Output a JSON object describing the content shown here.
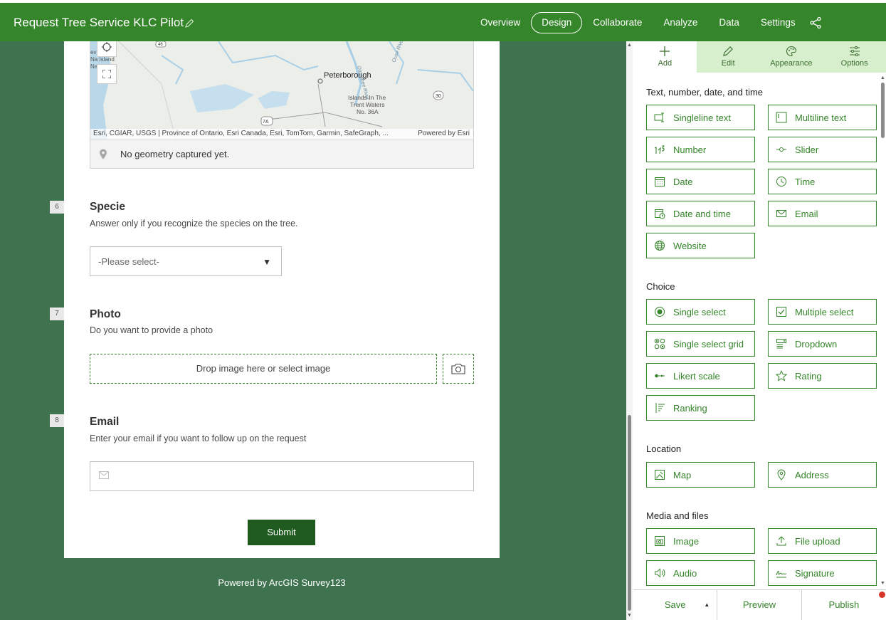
{
  "header": {
    "title": "Request Tree Service KLC Pilot",
    "nav": [
      "Overview",
      "Design",
      "Collaborate",
      "Analyze",
      "Data",
      "Settings"
    ],
    "active_nav": "Design"
  },
  "form": {
    "map": {
      "labels": [
        "Peterborough",
        "Islands In The",
        "Trent Waters",
        "No. 36A",
        "Na Island",
        "ev",
        "Na",
        "46",
        "30",
        "7A",
        "Otonabee River",
        "Ouse River"
      ],
      "attribution": "Esri, CGIAR, USGS | Province of Ontario, Esri Canada, Esri, TomTom, Garmin, SafeGraph, ...",
      "powered": "Powered by Esri",
      "status": "No geometry captured yet."
    },
    "questions": [
      {
        "number": "6",
        "title": "Specie",
        "hint": "Answer only if you recognize the species on the tree."
      },
      {
        "number": "7",
        "title": "Photo",
        "hint": "Do you want to provide a photo"
      },
      {
        "number": "8",
        "title": "Email",
        "hint": "Enter your email if you want to follow up on the request"
      }
    ],
    "specie_select": "-Please select-",
    "photo_drop": "Drop image here or select image",
    "submit": "Submit"
  },
  "footer": {
    "powered": "Powered by ArcGIS Survey123"
  },
  "panel": {
    "tabs": [
      {
        "label": "Add",
        "icon": "plus-icon"
      },
      {
        "label": "Edit",
        "icon": "pencil-icon"
      },
      {
        "label": "Appearance",
        "icon": "palette-icon"
      },
      {
        "label": "Options",
        "icon": "sliders-icon"
      }
    ],
    "active_tab": "Add",
    "sections": {
      "text": "Text, number, date, and time",
      "choice": "Choice",
      "location": "Location",
      "media": "Media and files"
    },
    "buttons": {
      "singleline": "Singleline text",
      "multiline": "Multiline text",
      "number": "Number",
      "slider": "Slider",
      "date": "Date",
      "time": "Time",
      "datetime": "Date and time",
      "email": "Email",
      "website": "Website",
      "single_select": "Single select",
      "multiple_select": "Multiple select",
      "single_select_grid": "Single select grid",
      "dropdown": "Dropdown",
      "likert": "Likert scale",
      "rating": "Rating",
      "ranking": "Ranking",
      "map": "Map",
      "address": "Address",
      "image": "Image",
      "file_upload": "File upload",
      "audio": "Audio",
      "signature": "Signature"
    },
    "footer": {
      "save": "Save",
      "preview": "Preview",
      "publish": "Publish"
    }
  },
  "colors": {
    "brand_green": "#35852a",
    "canvas_green": "#3f7350",
    "submit_green": "#1f5a1f",
    "tab_green": "#d7efcc"
  }
}
